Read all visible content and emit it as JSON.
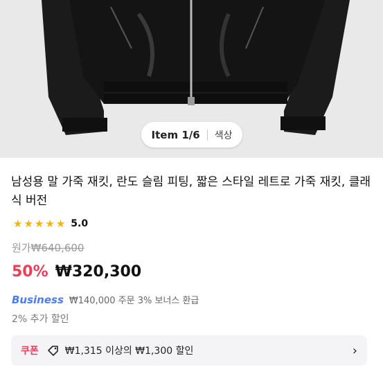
{
  "hero": {
    "pager": {
      "item_label": "Item 1/6",
      "option_label": "색상"
    }
  },
  "product": {
    "title": "남성용 말 가죽 재킷, 란도 슬림 피팅, 짧은 스타일 레트로 가죽 재킷, 클래식 버전",
    "rating": {
      "stars": 5,
      "score": "5.0"
    },
    "original_price": {
      "label": "원가",
      "value": "₩640,600"
    },
    "sale": {
      "discount": "50%",
      "price": "₩320,300"
    },
    "business": {
      "logo": "Business",
      "text": "₩140,000 주문 3% 보너스 환급"
    },
    "extra_discount": "2% 추가 할인",
    "coupon": {
      "tag": "쿠폰",
      "text": "₩1,315 이상의 ₩1,300 할인"
    }
  },
  "colors": {
    "accent": "#e8405b",
    "business": "#4a7ee8",
    "star": "#f4b400"
  }
}
